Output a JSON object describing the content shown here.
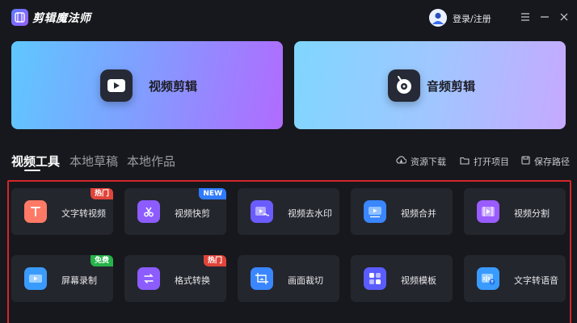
{
  "app": {
    "title": "剪辑魔法师"
  },
  "header": {
    "login_label": "登录/注册"
  },
  "cards": {
    "video_label": "视频剪辑",
    "audio_label": "音频剪辑"
  },
  "tabs": [
    {
      "label": "视频工具",
      "active": true
    },
    {
      "label": "本地草稿",
      "active": false
    },
    {
      "label": "本地作品",
      "active": false
    }
  ],
  "actions": {
    "download": "资源下载",
    "open": "打开项目",
    "save_path": "保存路径"
  },
  "tools": [
    {
      "label": "文字转视频",
      "icon": "text-to-video-icon",
      "badge": "热门",
      "badge_color": "#e0443a"
    },
    {
      "label": "视频快剪",
      "icon": "scissors-icon",
      "badge": "NEW",
      "badge_color": "#2f7bff"
    },
    {
      "label": "视频去水印",
      "icon": "remove-watermark-icon",
      "badge": "",
      "badge_color": ""
    },
    {
      "label": "视频合并",
      "icon": "merge-video-icon",
      "badge": "",
      "badge_color": ""
    },
    {
      "label": "视频分割",
      "icon": "split-video-icon",
      "badge": "",
      "badge_color": ""
    },
    {
      "label": "屏幕录制",
      "icon": "screen-record-icon",
      "badge": "免费",
      "badge_color": "#26b34a"
    },
    {
      "label": "格式转换",
      "icon": "format-convert-icon",
      "badge": "热门",
      "badge_color": "#e0443a"
    },
    {
      "label": "画面裁切",
      "icon": "crop-icon",
      "badge": "",
      "badge_color": ""
    },
    {
      "label": "视频模板",
      "icon": "template-icon",
      "badge": "",
      "badge_color": ""
    },
    {
      "label": "文字转语音",
      "icon": "text-to-speech-icon",
      "badge": "",
      "badge_color": ""
    }
  ],
  "colors": {
    "accent": "#5b7cff",
    "panel_border": "#d3262a",
    "hot": "#e0443a",
    "new": "#2f7bff",
    "free": "#26b34a"
  }
}
